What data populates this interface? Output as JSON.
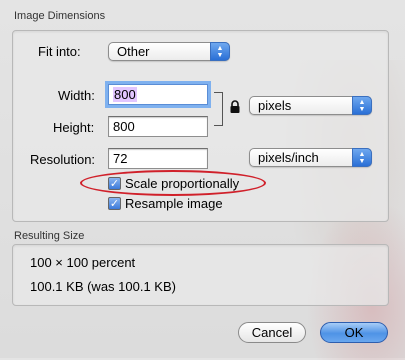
{
  "image_dimensions": {
    "title": "Image Dimensions",
    "fit_into_label": "Fit into:",
    "fit_into_value": "Other",
    "width_label": "Width:",
    "width_value": "800",
    "height_label": "Height:",
    "height_value": "800",
    "unit_value": "pixels",
    "resolution_label": "Resolution:",
    "resolution_value": "72",
    "resolution_unit": "pixels/inch",
    "scale_label": "Scale proportionally",
    "scale_checked": true,
    "resample_label": "Resample image",
    "resample_checked": true,
    "lock_icon": "lock-icon"
  },
  "resulting_size": {
    "title": "Resulting Size",
    "percent_text": "100 × 100 percent",
    "kb_text": "100.1 KB (was 100.1 KB)"
  },
  "buttons": {
    "cancel": "Cancel",
    "ok": "OK"
  },
  "colors": {
    "accent": "#3c7ad9",
    "highlight_ellipse": "#d0202a",
    "selection": "#e2c6ff"
  }
}
